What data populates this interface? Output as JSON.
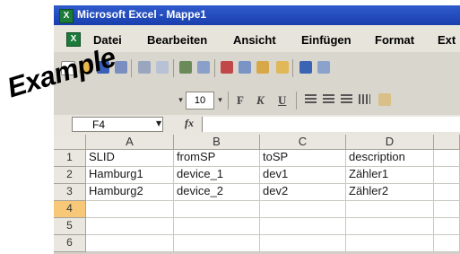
{
  "overlay_text": "Example",
  "window": {
    "title": "Microsoft Excel - Mappe1",
    "menu": [
      "Datei",
      "Bearbeiten",
      "Ansicht",
      "Einfügen",
      "Format",
      "Ext"
    ]
  },
  "toolbar": {
    "font_size": "10",
    "bold": "F",
    "italic": "K",
    "underline": "U"
  },
  "formula_bar": {
    "name_box": "F4",
    "fx": "fx",
    "content": ""
  },
  "sheet": {
    "columns": [
      "A",
      "B",
      "C",
      "D"
    ],
    "rows": [
      {
        "num": "1",
        "cells": [
          "SLID",
          "fromSP",
          "toSP",
          "description"
        ]
      },
      {
        "num": "2",
        "cells": [
          "Hamburg1",
          "device_1",
          "dev1",
          "Zähler1"
        ]
      },
      {
        "num": "3",
        "cells": [
          "Hamburg2",
          "device_2",
          "dev2",
          "Zähler2"
        ]
      },
      {
        "num": "4",
        "cells": [
          "",
          "",
          "",
          ""
        ]
      },
      {
        "num": "5",
        "cells": [
          "",
          "",
          "",
          ""
        ]
      },
      {
        "num": "6",
        "cells": [
          "",
          "",
          "",
          ""
        ]
      }
    ],
    "active_row": "4"
  }
}
